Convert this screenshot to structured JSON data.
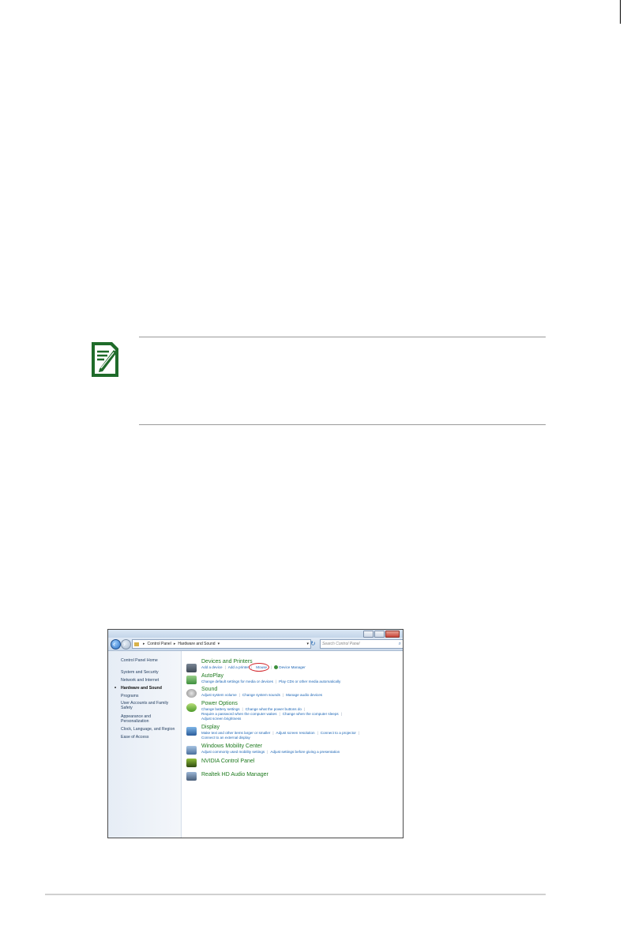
{
  "window": {
    "address": {
      "crumb1": "Control Panel",
      "crumb2": "Hardware and Sound"
    },
    "search_placeholder": "Search Control Panel"
  },
  "sidebar": {
    "home": "Control Panel Home",
    "items": [
      "System and Security",
      "Network and Internet",
      "Hardware and Sound",
      "Programs",
      "User Accounts and Family Safety",
      "Appearance and Personalization",
      "Clock, Language, and Region",
      "Ease of Access"
    ]
  },
  "categories": {
    "devices": {
      "title": "Devices and Printers",
      "links": [
        "Add a device",
        "Add a printer",
        "Mouse",
        "Device Manager"
      ]
    },
    "autoplay": {
      "title": "AutoPlay",
      "links": [
        "Change default settings for media or devices",
        "Play CDs or other media automatically"
      ]
    },
    "sound": {
      "title": "Sound",
      "links": [
        "Adjust system volume",
        "Change system sounds",
        "Manage audio devices"
      ]
    },
    "power": {
      "title": "Power Options",
      "links": [
        "Change battery settings",
        "Change what the power buttons do",
        "Require a password when the computer wakes",
        "Change when the computer sleeps",
        "Adjust screen brightness"
      ]
    },
    "display": {
      "title": "Display",
      "links": [
        "Make text and other items larger or smaller",
        "Adjust screen resolution",
        "Connect to a projector",
        "Connect to an external display"
      ]
    },
    "mobility": {
      "title": "Windows Mobility Center",
      "links": [
        "Adjust commonly used mobility settings",
        "Adjust settings before giving a presentation"
      ]
    },
    "nvidia": {
      "title": "NVIDIA Control Panel"
    },
    "realtek": {
      "title": "Realtek HD Audio Manager"
    }
  },
  "colors": {
    "category_title": "#1e7a1e",
    "link": "#1a64b5",
    "highlight_ring": "#d2242a",
    "note_icon": "#1f6b2a"
  }
}
